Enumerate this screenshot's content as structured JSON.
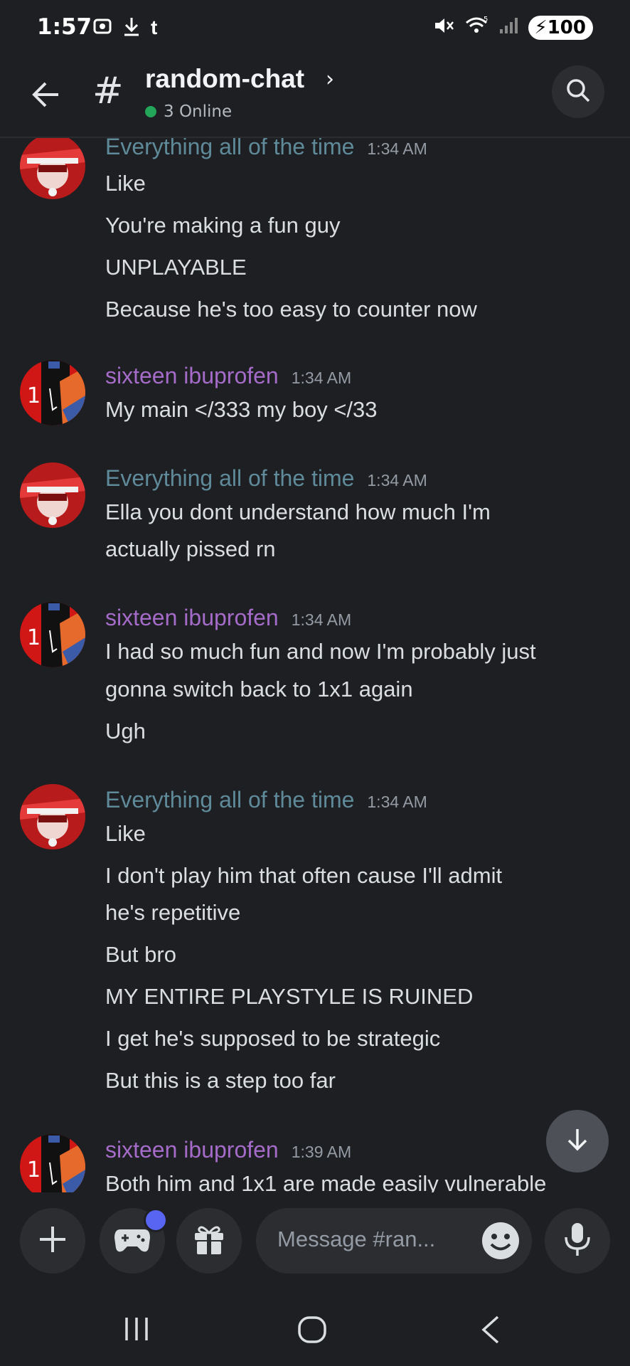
{
  "status_bar": {
    "time": "1:57",
    "battery": "100",
    "signal_label": "5"
  },
  "header": {
    "channel_name": "random-chat",
    "online_text": "3 Online"
  },
  "users": {
    "a": {
      "name": "Everything all of the time",
      "color": "#5f8a9a"
    },
    "b": {
      "name": "sixteen ibuprofen",
      "color": "#a46bc9"
    }
  },
  "messages": [
    {
      "author": "Everything all of the time",
      "time": "1:34 AM",
      "lines": [
        "Like",
        "You're making a fun guy",
        "UNPLAYABLE",
        "Because he's too easy to counter now"
      ]
    },
    {
      "author": "sixteen ibuprofen",
      "time": "1:34 AM",
      "lines": [
        "My main </333 my boy </33"
      ]
    },
    {
      "author": "Everything all of the time",
      "time": "1:34 AM",
      "lines": [
        "Ella you dont understand how much I'm",
        "actually pissed rn"
      ]
    },
    {
      "author": "sixteen ibuprofen",
      "time": "1:34 AM",
      "lines": [
        "I had so much fun and now I'm probably just",
        "gonna switch back to 1x1 again",
        "Ugh"
      ]
    },
    {
      "author": "Everything all of the time",
      "time": "1:34 AM",
      "lines": [
        "Like",
        "I don't play him that often cause I'll admit",
        "he's repetitive",
        "But bro",
        "MY ENTIRE PLAYSTYLE IS RUINED",
        "I get he's supposed to be strategic",
        "But this is a step too far"
      ]
    },
    {
      "author": "sixteen ibuprofen",
      "time": "1:39 AM",
      "lines": [
        "Both him and 1x1 are made easily vulnerable"
      ]
    }
  ],
  "composer": {
    "placeholder": "Message #ran..."
  }
}
